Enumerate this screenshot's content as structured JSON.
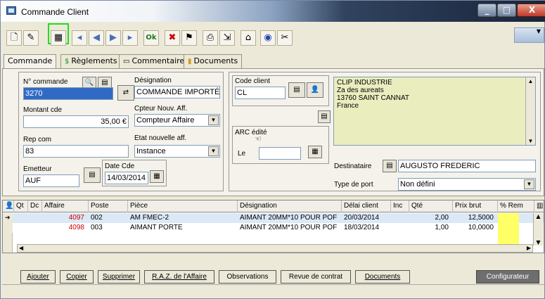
{
  "window": {
    "title": "Commande Client",
    "minimize": "_",
    "maximize": "□",
    "close": "X"
  },
  "toolbar": {
    "icons": [
      "new-doc-icon",
      "edit-icon",
      "grid-select-icon",
      "first-icon",
      "prev-icon",
      "next-icon",
      "last-icon",
      "ok-icon",
      "cancel-icon",
      "delete-icon",
      "print-icon",
      "export-icon",
      "trash-icon",
      "record-icon",
      "settings-icon"
    ]
  },
  "tabs": [
    {
      "label": "Commande"
    },
    {
      "label": "Règlements"
    },
    {
      "label": "Commentaires"
    },
    {
      "label": "Documents"
    }
  ],
  "form": {
    "n_commande": {
      "label": "N° commande",
      "value": "3270"
    },
    "designation": {
      "label": "Désignation",
      "value": "COMMANDE IMPORTÉE"
    },
    "montant": {
      "label": "Montant cde",
      "value": "35,00 €"
    },
    "cpteur": {
      "label": "Cpteur Nouv. Aff.",
      "value": "Compteur Affaire"
    },
    "rep": {
      "label": "Rep com",
      "value": "83"
    },
    "etat": {
      "label": "Etat nouvelle aff.",
      "value": "Instance"
    },
    "emetteur": {
      "label": "Emetteur",
      "value": "AUF"
    },
    "date_cde": {
      "label": "Date Cde",
      "value": "14/03/2014"
    },
    "code_client": {
      "label": "Code client",
      "value": "CL"
    },
    "arc": {
      "label": "ARC édité",
      "le": "Le",
      "value": ""
    },
    "address": {
      "line1": "CLIP INDUSTRIE",
      "line2": "Za des aureats",
      "line3": "13760 SAINT CANNAT",
      "line4": "France"
    },
    "destinataire": {
      "label": "Destinataire",
      "value": "AUGUSTO FREDERIC"
    },
    "port": {
      "label": "Type de port",
      "value": "Non défini"
    }
  },
  "grid": {
    "headers": [
      "Qt",
      "Dc",
      "Affaire",
      "Poste",
      "Pièce",
      "Désignation",
      "Délai client",
      "Inc",
      "Qté",
      "Prix brut",
      "% Rem"
    ],
    "rows": [
      {
        "affaire": "4097",
        "poste": "002",
        "piece": "AM FMEC-2",
        "designation": "AIMANT 20MM*10 POUR POF",
        "delai": "20/03/2014",
        "qte": "2,00",
        "prix": "12,5000"
      },
      {
        "affaire": "4098",
        "poste": "003",
        "piece": "AIMANT PORTE",
        "designation": "AIMANT 20MM*10 POUR POF",
        "delai": "18/03/2014",
        "qte": "1,00",
        "prix": "10,0000"
      }
    ]
  },
  "buttons": {
    "ajouter": "Ajouter",
    "copier": "Copier",
    "supprimer": "Supprimer",
    "raz": "R.A.Z. de l'Affaire",
    "observations": "Observations",
    "revue": "Revue de contrat",
    "documents": "Documents",
    "configurateur": "Configurateur"
  },
  "colors": {
    "accent": "#316ac5",
    "highlight": "#22dd22",
    "red_text": "#cc0000",
    "row_selected": "#dbe8f5",
    "yellow": "#ffff66"
  }
}
